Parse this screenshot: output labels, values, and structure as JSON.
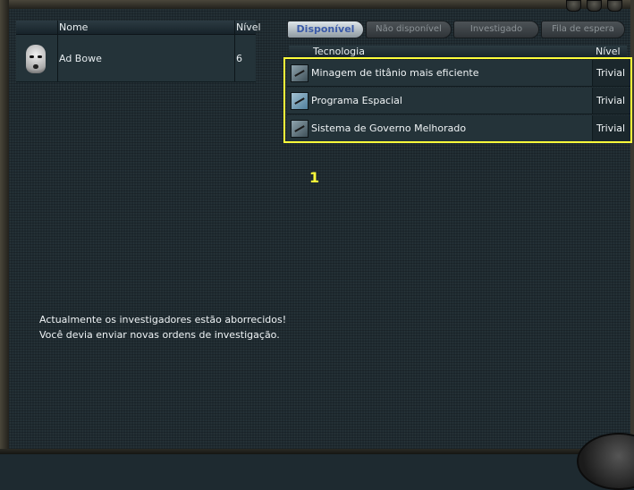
{
  "researchers": {
    "columns": {
      "name": "Nome",
      "level": "Nível"
    },
    "rows": [
      {
        "name": "Ad Bowe",
        "level": "6",
        "portrait": "mask-portrait-icon"
      }
    ]
  },
  "tabs": [
    {
      "label": "Disponível",
      "active": true
    },
    {
      "label": "Não disponível",
      "active": false
    },
    {
      "label": "Investigado",
      "active": false
    },
    {
      "label": "Fila de espera",
      "active": false
    }
  ],
  "tech_table": {
    "columns": {
      "tech": "Tecnologia",
      "level": "Nível"
    },
    "rows": [
      {
        "name": "Minagem de titânio mais eficiente",
        "level": "Trivial",
        "icon": "pickaxe-icon"
      },
      {
        "name": "Programa Espacial",
        "level": "Trivial",
        "icon": "satellite-icon"
      },
      {
        "name": "Sistema de Governo Melhorado",
        "level": "Trivial",
        "icon": "pickaxe-icon"
      }
    ]
  },
  "annotation_marker": "1",
  "messages": {
    "line1": "Actualmente os investigadores estão aborrecidos!",
    "line2": "Você devia enviar novas ordens de investigação."
  },
  "colors": {
    "highlight": "#ffff3a",
    "active_tab_text": "#3a5aa8",
    "background": "#1f2b31"
  }
}
